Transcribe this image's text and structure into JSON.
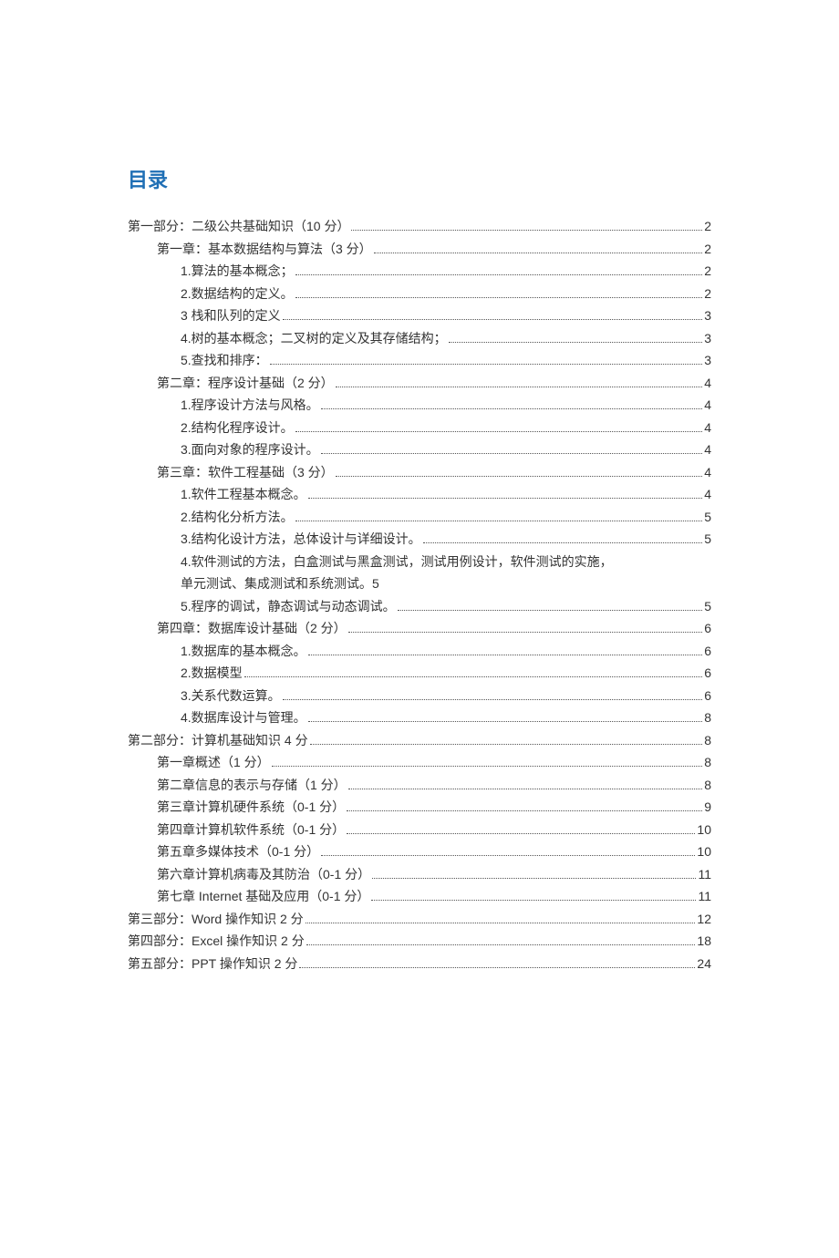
{
  "title": "目录",
  "entries": [
    {
      "level": 0,
      "text": "第一部分：二级公共基础知识（10 分）",
      "page": "2"
    },
    {
      "level": 1,
      "text": "第一章：基本数据结构与算法（3 分）",
      "page": "2"
    },
    {
      "level": 2,
      "text": "1.算法的基本概念；",
      "page": "2"
    },
    {
      "level": 2,
      "text": "2.数据结构的定义。",
      "page": "2"
    },
    {
      "level": 2,
      "text": "3 栈和队列的定义",
      "page": "3"
    },
    {
      "level": 2,
      "text": "4.树的基本概念；二叉树的定义及其存储结构；",
      "page": "3"
    },
    {
      "level": 2,
      "text": "5.查找和排序：",
      "page": "3"
    },
    {
      "level": 1,
      "text": "第二章：程序设计基础（2 分）",
      "page": "4"
    },
    {
      "level": 2,
      "text": "1.程序设计方法与风格。",
      "page": "4"
    },
    {
      "level": 2,
      "text": "2.结构化程序设计。",
      "page": "4"
    },
    {
      "level": 2,
      "text": "3.面向对象的程序设计。",
      "page": "4"
    },
    {
      "level": 1,
      "text": "第三章：软件工程基础（3 分）",
      "page": "4"
    },
    {
      "level": 2,
      "text": "1.软件工程基本概念。",
      "page": "4"
    },
    {
      "level": 2,
      "text": "2.结构化分析方法。",
      "page": "5"
    },
    {
      "level": 2,
      "text": "3.结构化设计方法，总体设计与详细设计。",
      "page": "5"
    },
    {
      "level": 2,
      "wrap": true,
      "line1": "4.软件测试的方法，白盒测试与黑盒测试，测试用例设计，软件测试的实施，",
      "line2": "单元测试、集成测试和系统测试。",
      "page": "5"
    },
    {
      "level": 2,
      "text": "5.程序的调试，静态调试与动态调试。",
      "page": "5"
    },
    {
      "level": 1,
      "text": "第四章：数据库设计基础（2 分）",
      "page": "6"
    },
    {
      "level": 2,
      "text": "1.数据库的基本概念。",
      "page": "6"
    },
    {
      "level": 2,
      "text": "2.数据模型",
      "page": "6"
    },
    {
      "level": 2,
      "text": "3.关系代数运算。",
      "page": "6"
    },
    {
      "level": 2,
      "text": "4.数据库设计与管理。",
      "page": "8"
    },
    {
      "level": 0,
      "text": "第二部分：计算机基础知识 4 分",
      "page": "8"
    },
    {
      "level": 1,
      "text": "第一章概述（1 分）",
      "page": "8"
    },
    {
      "level": 1,
      "text": "第二章信息的表示与存储（1 分）",
      "page": "8"
    },
    {
      "level": 1,
      "text": "第三章计算机硬件系统（0-1 分）",
      "page": "9"
    },
    {
      "level": 1,
      "text": "第四章计算机软件系统（0-1 分）",
      "page": "10"
    },
    {
      "level": 1,
      "text": "第五章多媒体技术（0-1 分）",
      "page": "10"
    },
    {
      "level": 1,
      "text": "第六章计算机病毒及其防治（0-1 分）",
      "page": "11"
    },
    {
      "level": 1,
      "text": "第七章 Internet 基础及应用（0-1 分）",
      "page": "11"
    },
    {
      "level": 0,
      "text": "第三部分：Word 操作知识 2 分",
      "page": "12"
    },
    {
      "level": 0,
      "text": "第四部分：Excel 操作知识 2 分",
      "page": "18"
    },
    {
      "level": 0,
      "text": "第五部分：PPT 操作知识 2 分",
      "page": "24"
    }
  ]
}
